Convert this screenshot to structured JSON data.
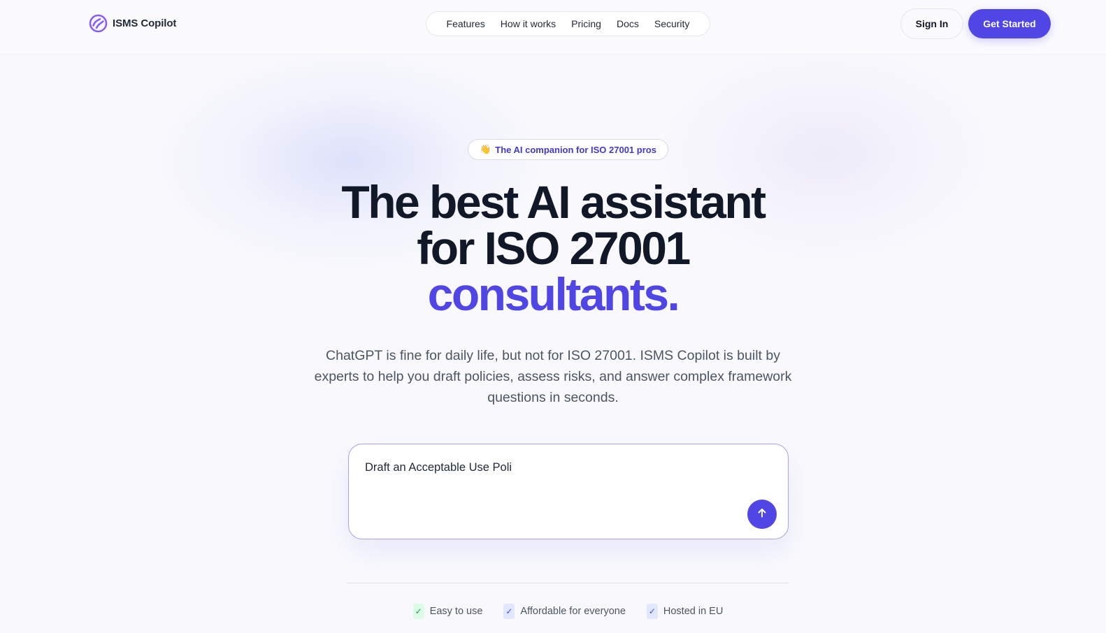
{
  "brand": {
    "name": "ISMS Copilot",
    "logo_icon": "swirl-logo-icon",
    "accent_color": "#4f46e5",
    "logo_color": "#8b5cf6"
  },
  "nav": {
    "items": [
      "Features",
      "How it works",
      "Pricing",
      "Docs",
      "Security"
    ]
  },
  "header_actions": {
    "sign_in": "Sign In",
    "get_started": "Get Started"
  },
  "hero": {
    "badge_icon": "👋",
    "badge_text": "The AI companion for ISO 27001 pros",
    "headline_line1": "The best AI assistant",
    "headline_line2": "for ISO 27001",
    "headline_line3": "consultants.",
    "subtitle": "ChatGPT is fine for daily life, but not for ISO 27001. ISMS Copilot is built by experts to help you draft policies, assess risks, and answer complex framework questions in seconds."
  },
  "prompt": {
    "value": "Draft an Acceptable Use Poli",
    "send_icon": "arrow-up-icon"
  },
  "features": [
    {
      "label": "Easy to use",
      "check_color": "green"
    },
    {
      "label": "Affordable for everyone",
      "check_color": "blue"
    },
    {
      "label": "Hosted in EU",
      "check_color": "blue"
    }
  ],
  "check_glyph": "✓"
}
